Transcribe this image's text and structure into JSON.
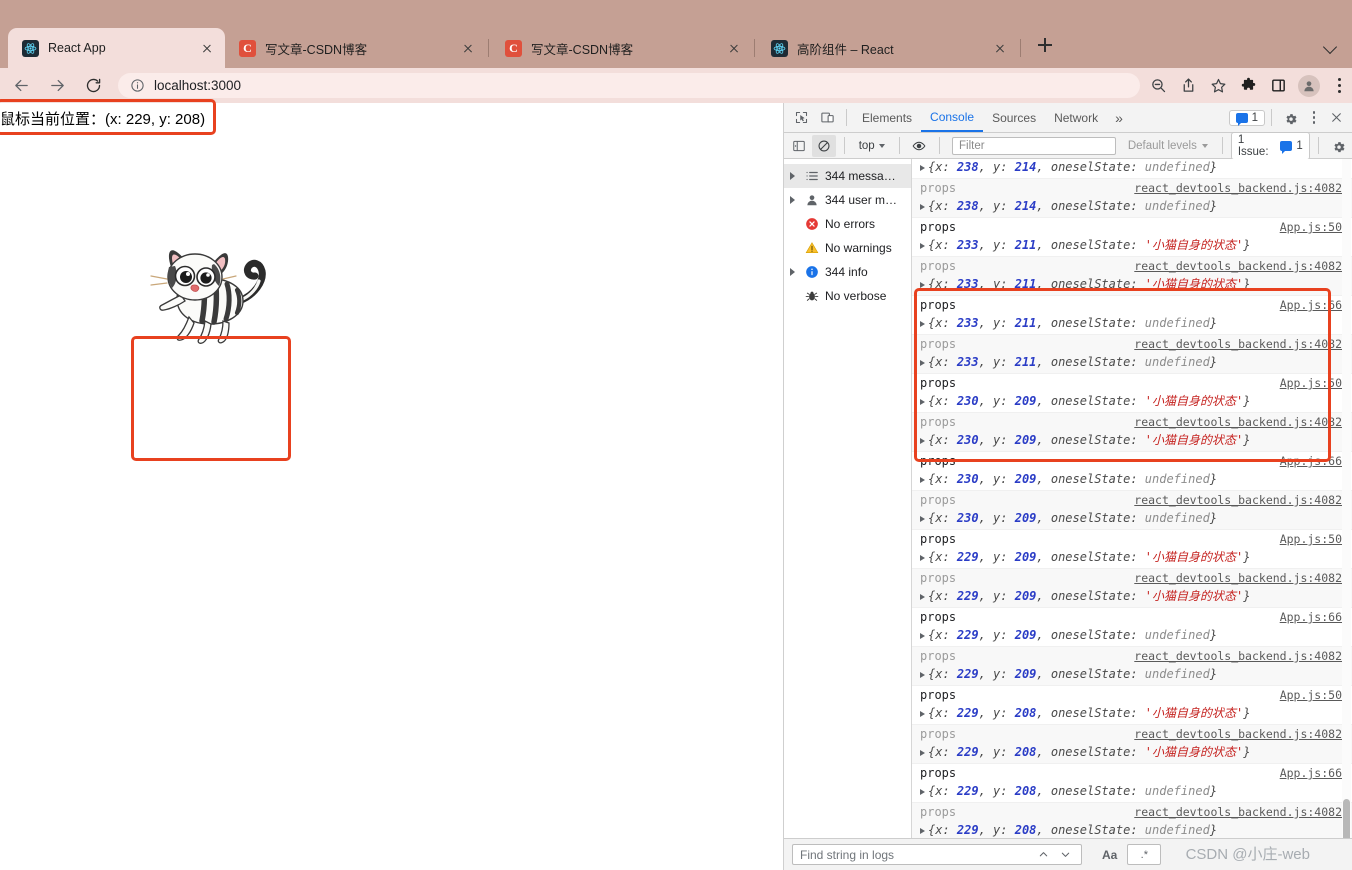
{
  "browser": {
    "tabs": [
      {
        "title": "React App",
        "favicon": "react-icon",
        "active": true
      },
      {
        "title": "写文章-CSDN博客",
        "favicon": "csdn-icon",
        "active": false
      },
      {
        "title": "写文章-CSDN博客",
        "favicon": "csdn-icon",
        "active": false
      },
      {
        "title": "高阶组件 – React",
        "favicon": "react-icon",
        "active": false
      }
    ],
    "new_tab_label": "+",
    "url": "localhost:3000",
    "nav": {
      "back": "back-icon",
      "forward": "forward-icon",
      "reload": "reload-icon"
    },
    "toolbar_icons": [
      "search-icon",
      "share-icon",
      "bookmark-star-icon",
      "extensions-puzzle-icon",
      "side-panel-icon",
      "profile-avatar-icon",
      "browser-menu-icon"
    ]
  },
  "page": {
    "mouse_position_label": "鼠标当前位置：",
    "mouse_position_value": "(x: 229, y: 208)",
    "cat_image_alt": "cartoon-cat-illustration"
  },
  "annotations": {
    "accent_color": "#e8411f",
    "boxes": [
      "mouse-position",
      "cat-image",
      "console-log-group"
    ]
  },
  "devtools": {
    "tabs": [
      {
        "label": "Elements",
        "active": false
      },
      {
        "label": "Console",
        "active": true
      },
      {
        "label": "Sources",
        "active": false
      },
      {
        "label": "Network",
        "active": false
      }
    ],
    "more_tabs_label": "»",
    "message_badge_count": "1",
    "issues_label": "1 Issue:",
    "issues_count": "1",
    "context_selector": "top",
    "filter_placeholder": "Filter",
    "levels_label": "Default levels",
    "sidebar": [
      {
        "label": "344 messa…",
        "icon": "list-icon",
        "expandable": true,
        "selected": true
      },
      {
        "label": "344 user m…",
        "icon": "user-icon",
        "expandable": true,
        "selected": false
      },
      {
        "label": "No errors",
        "icon": "error-icon",
        "expandable": false,
        "selected": false
      },
      {
        "label": "No warnings",
        "icon": "warning-icon",
        "expandable": false,
        "selected": false
      },
      {
        "label": "344 info",
        "icon": "info-icon",
        "expandable": true,
        "selected": false
      },
      {
        "label": "No verbose",
        "icon": "verbose-bug-icon",
        "expandable": false,
        "selected": false
      }
    ],
    "log_label": "props",
    "logs": [
      {
        "source": "",
        "x": "238",
        "y": "214",
        "state": "undefined",
        "state_type": "undef",
        "alt": false,
        "partial_top": true
      },
      {
        "source": "react_devtools_backend.js:4082",
        "x": "238",
        "y": "214",
        "state": "undefined",
        "state_type": "undef",
        "alt": true
      },
      {
        "source": "App.js:50",
        "x": "233",
        "y": "211",
        "state": "'小猫自身的状态'",
        "state_type": "str",
        "alt": false
      },
      {
        "source": "react_devtools_backend.js:4082",
        "x": "233",
        "y": "211",
        "state": "'小猫自身的状态'",
        "state_type": "str",
        "alt": true
      },
      {
        "source": "App.js:66",
        "x": "233",
        "y": "211",
        "state": "undefined",
        "state_type": "undef",
        "alt": false
      },
      {
        "source": "react_devtools_backend.js:4082",
        "x": "233",
        "y": "211",
        "state": "undefined",
        "state_type": "undef",
        "alt": true
      },
      {
        "source": "App.js:50",
        "x": "230",
        "y": "209",
        "state": "'小猫自身的状态'",
        "state_type": "str",
        "alt": false
      },
      {
        "source": "react_devtools_backend.js:4082",
        "x": "230",
        "y": "209",
        "state": "'小猫自身的状态'",
        "state_type": "str",
        "alt": true
      },
      {
        "source": "App.js:66",
        "x": "230",
        "y": "209",
        "state": "undefined",
        "state_type": "undef",
        "alt": false
      },
      {
        "source": "react_devtools_backend.js:4082",
        "x": "230",
        "y": "209",
        "state": "undefined",
        "state_type": "undef",
        "alt": true
      },
      {
        "source": "App.js:50",
        "x": "229",
        "y": "209",
        "state": "'小猫自身的状态'",
        "state_type": "str",
        "alt": false
      },
      {
        "source": "react_devtools_backend.js:4082",
        "x": "229",
        "y": "209",
        "state": "'小猫自身的状态'",
        "state_type": "str",
        "alt": true
      },
      {
        "source": "App.js:66",
        "x": "229",
        "y": "209",
        "state": "undefined",
        "state_type": "undef",
        "alt": false
      },
      {
        "source": "react_devtools_backend.js:4082",
        "x": "229",
        "y": "209",
        "state": "undefined",
        "state_type": "undef",
        "alt": true
      },
      {
        "source": "App.js:50",
        "x": "229",
        "y": "208",
        "state": "'小猫自身的状态'",
        "state_type": "str",
        "alt": false
      },
      {
        "source": "react_devtools_backend.js:4082",
        "x": "229",
        "y": "208",
        "state": "'小猫自身的状态'",
        "state_type": "str",
        "alt": true
      },
      {
        "source": "App.js:66",
        "x": "229",
        "y": "208",
        "state": "undefined",
        "state_type": "undef",
        "alt": false
      },
      {
        "source": "react_devtools_backend.js:4082",
        "x": "229",
        "y": "208",
        "state": "undefined",
        "state_type": "undef",
        "alt": true
      }
    ],
    "prompt_caret": ">",
    "find_placeholder": "Find string in logs",
    "find_match_case_label": "Aa",
    "find_regex_label": ".*"
  },
  "watermark": "CSDN @小庄-web",
  "colors": {
    "tabstrip": "#c5a094",
    "toolbar": "#f3dedb",
    "omnibox": "#fbecea",
    "accent_red": "#e8411f",
    "devtools_chrome": "#f3f3f3",
    "link_blue": "#1a73e8",
    "number_blue": "#2a3cc6",
    "string_red": "#c5221f"
  }
}
